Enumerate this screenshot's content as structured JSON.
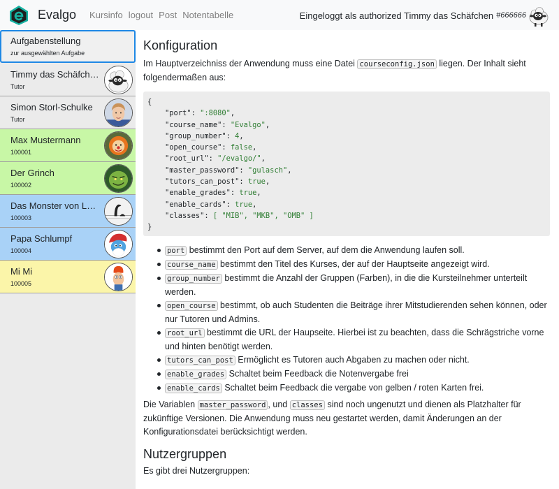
{
  "navbar": {
    "brand": "Evalgo",
    "links": [
      "Kursinfo",
      "logout",
      "Post",
      "Notentabelle"
    ],
    "login_text": "Eingeloggt als authorized Timmy das Schäfchen",
    "login_id": "#666666"
  },
  "sidebar": {
    "items": [
      {
        "name": "Aufgabenstellung",
        "sub": "zur ausgewählten Aufgabe",
        "color": "#f0f0f0",
        "avatar": ""
      },
      {
        "name": "Timmy das Schäfchen",
        "sub": "Tutor",
        "color": "#ebebeb",
        "avatar": "sheep"
      },
      {
        "name": "Simon Storl-Schulke",
        "sub": "Tutor",
        "color": "#ebebeb",
        "avatar": "person"
      },
      {
        "name": "Max Mustermann",
        "sub": "100001",
        "color": "#c8f7a6",
        "avatar": "clown"
      },
      {
        "name": "Der Grinch",
        "sub": "100002",
        "color": "#c8f7a6",
        "avatar": "grinch"
      },
      {
        "name": "Das Monster von Loc...",
        "sub": "100003",
        "color": "#a9d2f7",
        "avatar": "nessie"
      },
      {
        "name": "Papa Schlumpf",
        "sub": "100004",
        "color": "#a9d2f7",
        "avatar": "smurf"
      },
      {
        "name": "Mi Mi",
        "sub": "100005",
        "color": "#fbf5a9",
        "avatar": "beaker"
      }
    ]
  },
  "main": {
    "heading_config": "Konfiguration",
    "p1_a": "Im Hauptverzeichniss der Anwendung muss eine Datei ",
    "p1_code": "courseconfig.json",
    "p1_b": " liegen. Der Inhalt sieht folgendermaßen aus:",
    "config": {
      "open": "{",
      "close": "}",
      "lines": [
        {
          "key": "\"port\"",
          "value": "\":8080\"",
          "comma": ","
        },
        {
          "key": "\"course_name\"",
          "value": "\"Evalgo\"",
          "comma": ","
        },
        {
          "key": "\"group_number\"",
          "value": "4",
          "comma": ","
        },
        {
          "key": "\"open_course\"",
          "value": "false",
          "comma": ","
        },
        {
          "key": "\"root_url\"",
          "value": "\"/evalgo/\"",
          "comma": ","
        },
        {
          "key": "\"master_password\"",
          "value": "\"gulasch\"",
          "comma": ","
        },
        {
          "key": "\"tutors_can_post\"",
          "value": "true",
          "comma": ","
        },
        {
          "key": "\"enable_grades\"",
          "value": "true",
          "comma": ","
        },
        {
          "key": "\"enable_cards\"",
          "value": "true",
          "comma": ","
        },
        {
          "key": "\"classes\"",
          "value": "[ \"MIB\", \"MKB\", \"OMB\" ]",
          "comma": ""
        }
      ]
    },
    "options": [
      {
        "code": "port",
        "text": " bestimmt den Port auf dem Server, auf dem die Anwendung laufen soll."
      },
      {
        "code": "course_name",
        "text": " bestimmt den Titel des Kurses, der auf der Hauptseite angezeigt wird."
      },
      {
        "code": "group_number",
        "text": " bestimmt die Anzahl der Gruppen (Farben), in die die Kursteilnehmer unterteilt werden."
      },
      {
        "code": "open_course",
        "text": " bestimmt, ob auch Studenten die Beiträge ihrer Mitstudierenden sehen können, oder nur Tutoren und Admins."
      },
      {
        "code": "root_url",
        "text": " bestimmt die URL der Haupseite. Hierbei ist zu beachten, dass die Schrägstriche vorne und hinten benötigt werden."
      },
      {
        "code": "tutors_can_post",
        "text": " Ermöglicht es Tutoren auch Abgaben zu machen oder nicht."
      },
      {
        "code": "enable_grades",
        "text": " Schaltet beim Feedback die Notenvergabe frei"
      },
      {
        "code": "enable_cards",
        "text": " Schaltet beim Feedback die vergabe von gelben / roten Karten frei."
      }
    ],
    "p2_a": "Die Variablen ",
    "p2_code1": "master_password",
    "p2_b": ", und ",
    "p2_code2": "classes",
    "p2_c": " sind noch ungenutzt und dienen als Platzhalter für zukünftige Versionen. Die Anwendung muss neu gestartet werden, damit Änderungen an der Konfigurationsdatei berücksichtigt werden.",
    "heading_groups": "Nutzergruppen",
    "p3": "Es gibt drei Nutzergruppen:"
  },
  "colors": {
    "accent": "#1e88e5",
    "logo": "#17b3a3",
    "green_group": "#c8f7a6",
    "blue_group": "#a9d2f7",
    "yellow_group": "#fbf5a9"
  }
}
